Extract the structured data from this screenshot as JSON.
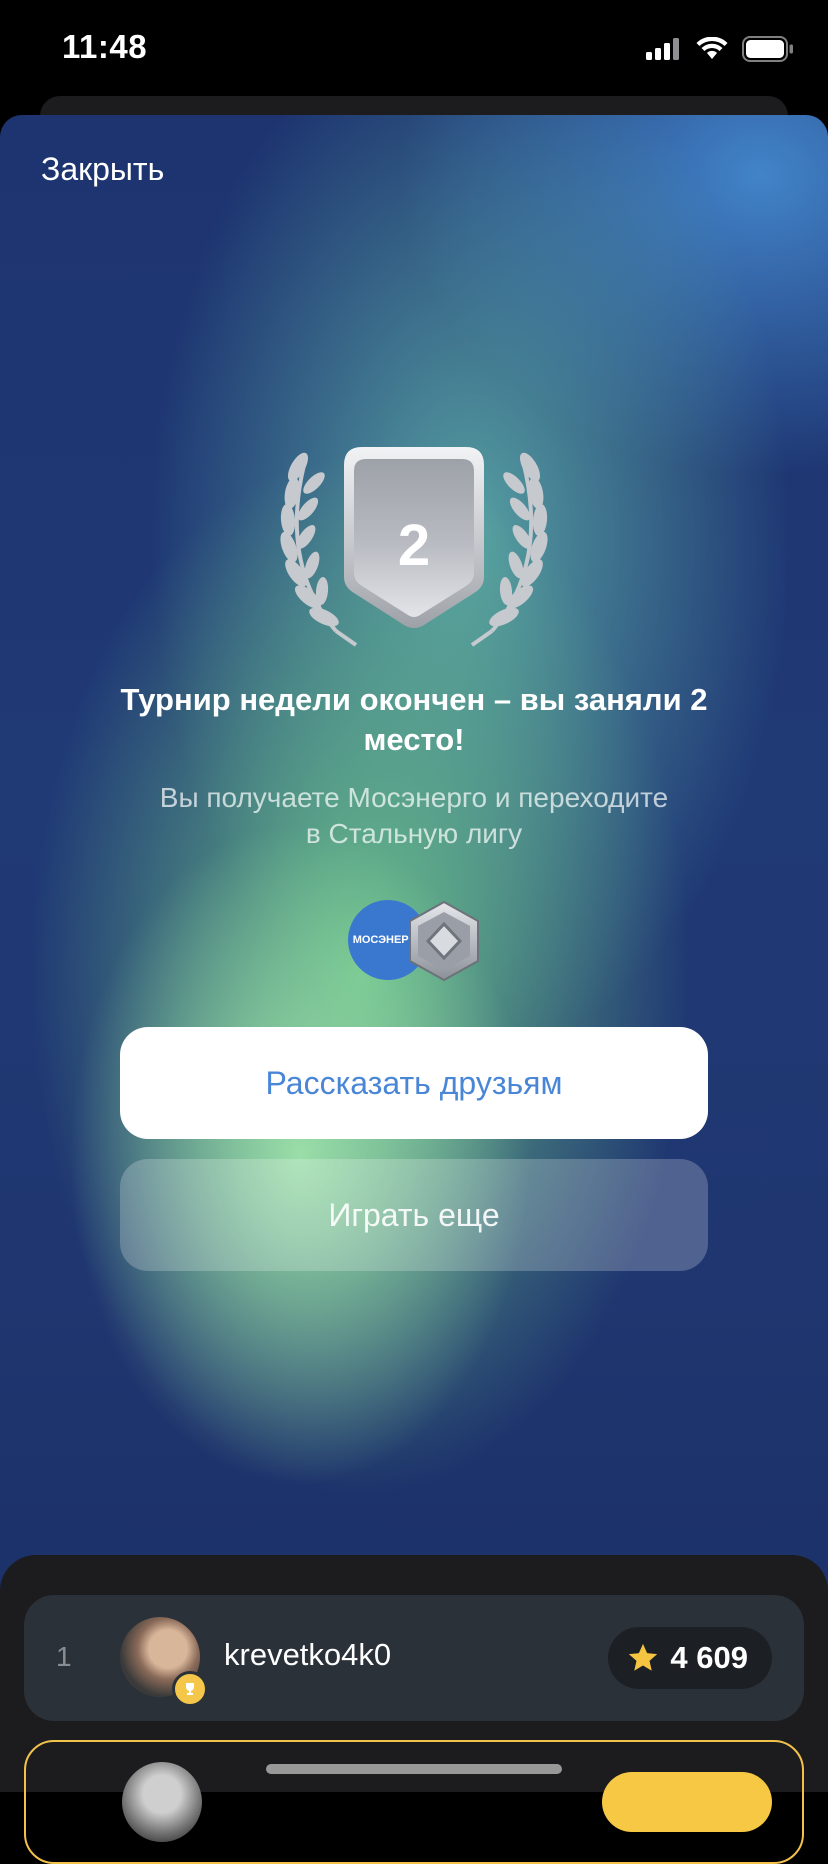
{
  "status_bar": {
    "time": "11:48"
  },
  "header": {
    "close_label": "Закрыть"
  },
  "result": {
    "place": "2",
    "headline": "Турнир недели окончен – вы заняли 2 место!",
    "subtitle": "Вы получаете Мосэнерго и переходите в Стальную лигу",
    "reward_company_logo_text": "МОСЭНЕРГО"
  },
  "buttons": {
    "share_label": "Рассказать друзьям",
    "play_label": "Играть еще"
  },
  "leaderboard": {
    "rows": [
      {
        "rank": "1",
        "username": "krevetko4k0",
        "score": "4 609"
      }
    ]
  },
  "colors": {
    "accent_blue": "#4a86d6",
    "gold": "#f4c64a",
    "silver": "#c8cbd0"
  }
}
